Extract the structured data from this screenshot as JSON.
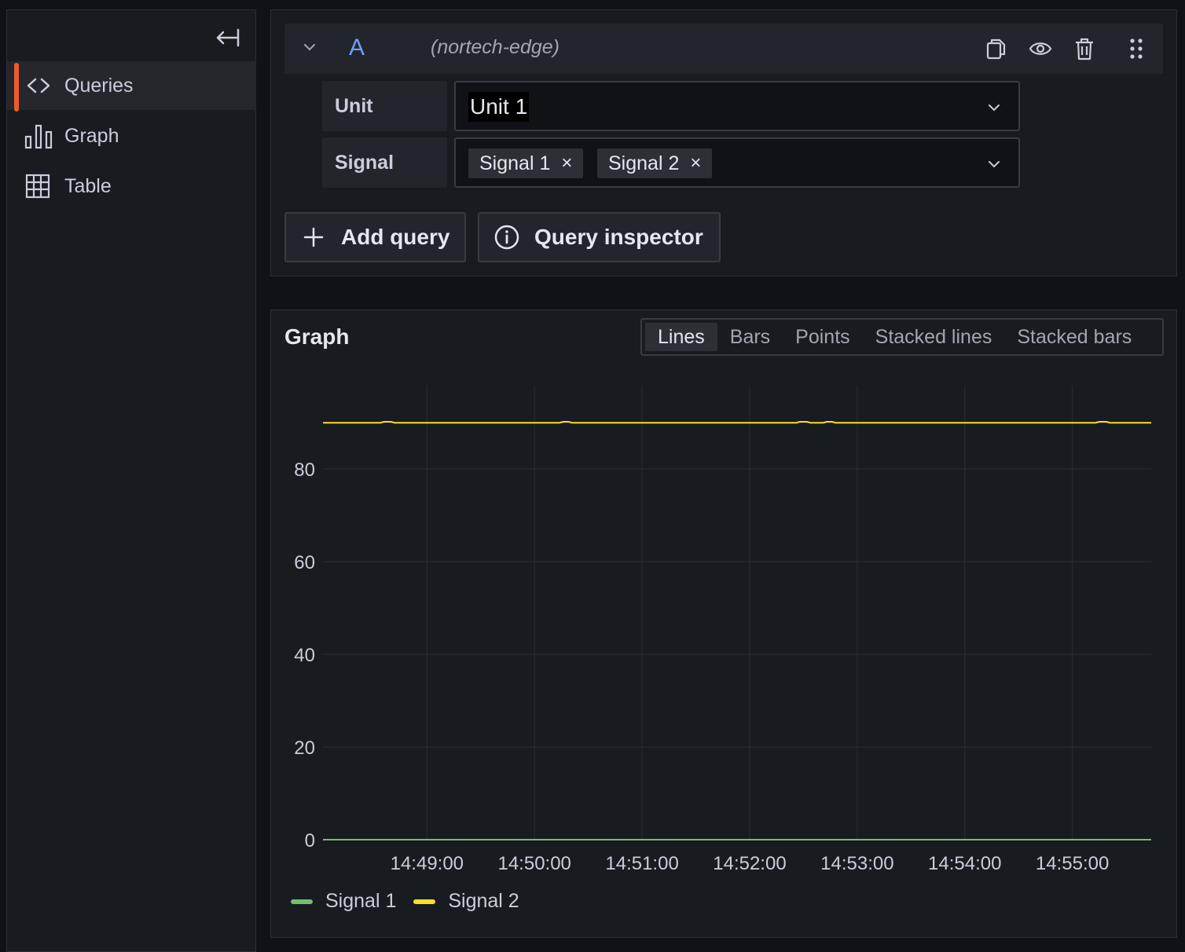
{
  "sidebar": {
    "items": [
      {
        "label": "Queries",
        "icon": "code-icon",
        "active": true
      },
      {
        "label": "Graph",
        "icon": "bar-chart-icon",
        "active": false
      },
      {
        "label": "Table",
        "icon": "table-icon",
        "active": false
      }
    ]
  },
  "query": {
    "ref_id": "A",
    "datasource": "(nortech-edge)",
    "unit_label": "Unit",
    "unit_value": "Unit 1",
    "signal_label": "Signal",
    "signals": [
      "Signal 1",
      "Signal 2"
    ],
    "chip_remove": "×"
  },
  "buttons": {
    "add_query": "Add query",
    "query_inspector": "Query inspector"
  },
  "graph": {
    "title": "Graph",
    "modes": [
      "Lines",
      "Bars",
      "Points",
      "Stacked lines",
      "Stacked bars"
    ],
    "selected_mode": "Lines"
  },
  "colors": {
    "accent": "#f05a28",
    "ref_id": "#6e9fff",
    "signal_1": "#73bf69",
    "signal_2": "#fade2a"
  },
  "chart_data": {
    "type": "line",
    "x_ticks": [
      "14:49:00",
      "14:50:00",
      "14:51:00",
      "14:52:00",
      "14:53:00",
      "14:54:00",
      "14:55:00"
    ],
    "y_ticks": [
      0,
      20,
      40,
      60,
      80
    ],
    "xlim": [
      "14:48:02",
      "14:55:44"
    ],
    "ylim": [
      0,
      98
    ],
    "series": [
      {
        "name": "Signal 1",
        "color": "#73bf69",
        "x": [
          "14:48:02",
          "14:55:44"
        ],
        "y": [
          0,
          0
        ]
      },
      {
        "name": "Signal 2",
        "color": "#fade2a",
        "x": [
          "14:48:02",
          "14:48:34",
          "14:48:36",
          "14:48:40",
          "14:48:42",
          "14:50:14",
          "14:50:16",
          "14:50:19",
          "14:50:21",
          "14:52:26",
          "14:52:28",
          "14:52:32",
          "14:52:34",
          "14:52:41",
          "14:52:43",
          "14:52:46",
          "14:52:48",
          "14:55:13",
          "14:55:15",
          "14:55:19",
          "14:55:21",
          "14:55:44"
        ],
        "y": [
          90,
          90,
          90.2,
          90.2,
          90,
          90,
          90.2,
          90.2,
          90,
          90,
          90.2,
          90.2,
          90,
          90,
          90.2,
          90.2,
          90,
          90,
          90.2,
          90.2,
          90,
          90
        ]
      }
    ],
    "grid": true,
    "legend": "bottom-left"
  }
}
